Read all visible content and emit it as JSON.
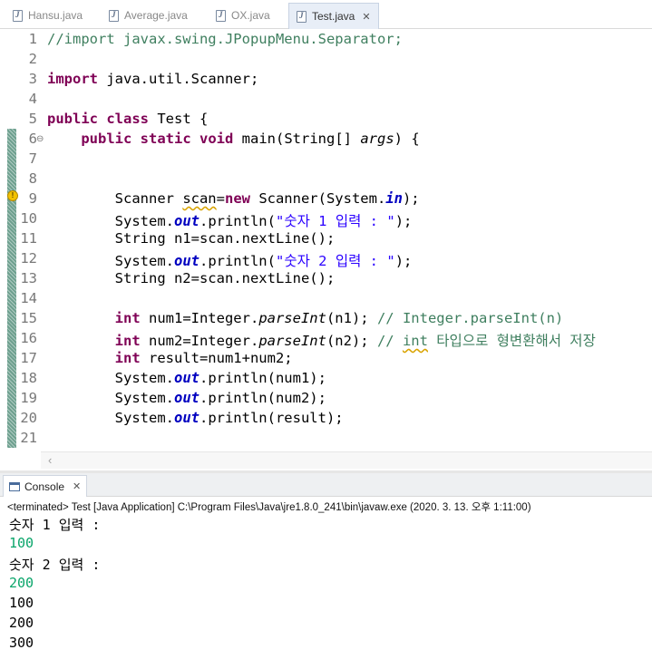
{
  "tabs": [
    {
      "label": "Hansu.java"
    },
    {
      "label": "Average.java"
    },
    {
      "label": "OX.java"
    },
    {
      "label": "Test.java",
      "active": true
    }
  ],
  "editor": {
    "lines": [
      {
        "num": "1",
        "parts": [
          {
            "t": "//import javax.swing.JPopupMenu.Separator;",
            "c": "cm"
          }
        ]
      },
      {
        "num": "2",
        "parts": []
      },
      {
        "num": "3",
        "parts": [
          {
            "t": "import",
            "c": "kw"
          },
          {
            "t": " java.util.Scanner;"
          }
        ]
      },
      {
        "num": "4",
        "parts": []
      },
      {
        "num": "5",
        "parts": [
          {
            "t": "public",
            "c": "kw"
          },
          {
            "t": " "
          },
          {
            "t": "class",
            "c": "kw"
          },
          {
            "t": " Test {"
          }
        ]
      },
      {
        "num": "6",
        "parts": [
          {
            "t": "    "
          },
          {
            "t": "public",
            "c": "kw"
          },
          {
            "t": " "
          },
          {
            "t": "static",
            "c": "kw"
          },
          {
            "t": " "
          },
          {
            "t": "void",
            "c": "kw"
          },
          {
            "t": " main(String[] "
          },
          {
            "t": "args",
            "c": "it"
          },
          {
            "t": ") {"
          }
        ]
      },
      {
        "num": "7",
        "parts": []
      },
      {
        "num": "8",
        "parts": []
      },
      {
        "num": "9",
        "parts": [
          {
            "t": "        Scanner "
          },
          {
            "t": "scan",
            "c": "wv"
          },
          {
            "t": "="
          },
          {
            "t": "new",
            "c": "kw"
          },
          {
            "t": " Scanner(System."
          },
          {
            "t": "in",
            "c": "fld"
          },
          {
            "t": ");"
          }
        ]
      },
      {
        "num": "10",
        "parts": [
          {
            "t": "        System."
          },
          {
            "t": "out",
            "c": "fld"
          },
          {
            "t": ".println("
          },
          {
            "t": "\"숫자 1 입력 : \"",
            "c": "st"
          },
          {
            "t": ");"
          }
        ]
      },
      {
        "num": "11",
        "parts": [
          {
            "t": "        String n1=scan.nextLine();"
          }
        ]
      },
      {
        "num": "12",
        "parts": [
          {
            "t": "        System."
          },
          {
            "t": "out",
            "c": "fld"
          },
          {
            "t": ".println("
          },
          {
            "t": "\"숫자 2 입력 : \"",
            "c": "st"
          },
          {
            "t": ");"
          }
        ]
      },
      {
        "num": "13",
        "parts": [
          {
            "t": "        String n2=scan.nextLine();"
          }
        ]
      },
      {
        "num": "14",
        "parts": []
      },
      {
        "num": "15",
        "parts": [
          {
            "t": "        "
          },
          {
            "t": "int",
            "c": "kw"
          },
          {
            "t": " num1=Integer."
          },
          {
            "t": "parseInt",
            "c": "it"
          },
          {
            "t": "(n1); "
          },
          {
            "t": "// Integer.parseInt(n)",
            "c": "cm"
          }
        ]
      },
      {
        "num": "16",
        "parts": [
          {
            "t": "        "
          },
          {
            "t": "int",
            "c": "kw"
          },
          {
            "t": " num2=Integer."
          },
          {
            "t": "parseInt",
            "c": "it"
          },
          {
            "t": "(n2); "
          },
          {
            "t": "// ",
            "c": "cm"
          },
          {
            "t": "int",
            "c": "cm wv"
          },
          {
            "t": " 타입으로 형변환해서 저장",
            "c": "cm"
          }
        ]
      },
      {
        "num": "17",
        "parts": [
          {
            "t": "        "
          },
          {
            "t": "int",
            "c": "kw"
          },
          {
            "t": " result=num1+num2;"
          }
        ]
      },
      {
        "num": "18",
        "parts": [
          {
            "t": "        System."
          },
          {
            "t": "out",
            "c": "fld"
          },
          {
            "t": ".println(num1);"
          }
        ]
      },
      {
        "num": "19",
        "parts": [
          {
            "t": "        System."
          },
          {
            "t": "out",
            "c": "fld"
          },
          {
            "t": ".println(num2);"
          }
        ]
      },
      {
        "num": "20",
        "parts": [
          {
            "t": "        System."
          },
          {
            "t": "out",
            "c": "fld"
          },
          {
            "t": ".println(result);"
          }
        ]
      },
      {
        "num": "21",
        "parts": []
      }
    ]
  },
  "console": {
    "tab_label": "Console",
    "status": "<terminated> Test [Java Application] C:\\Program Files\\Java\\jre1.8.0_241\\bin\\javaw.exe (2020. 3. 13. 오후 1:11:00)",
    "output": [
      {
        "text": "숫자 1 입력 :",
        "input": false
      },
      {
        "text": "100",
        "input": true
      },
      {
        "text": "숫자 2 입력 :",
        "input": false
      },
      {
        "text": "200",
        "input": true
      },
      {
        "text": "100",
        "input": false
      },
      {
        "text": "200",
        "input": false
      },
      {
        "text": "300",
        "input": false
      }
    ]
  },
  "colors": {
    "keyword": "#7f0055",
    "comment": "#3f7f5f",
    "string": "#2a00ff",
    "field": "#0000c0",
    "console_input": "#0aa56a"
  }
}
